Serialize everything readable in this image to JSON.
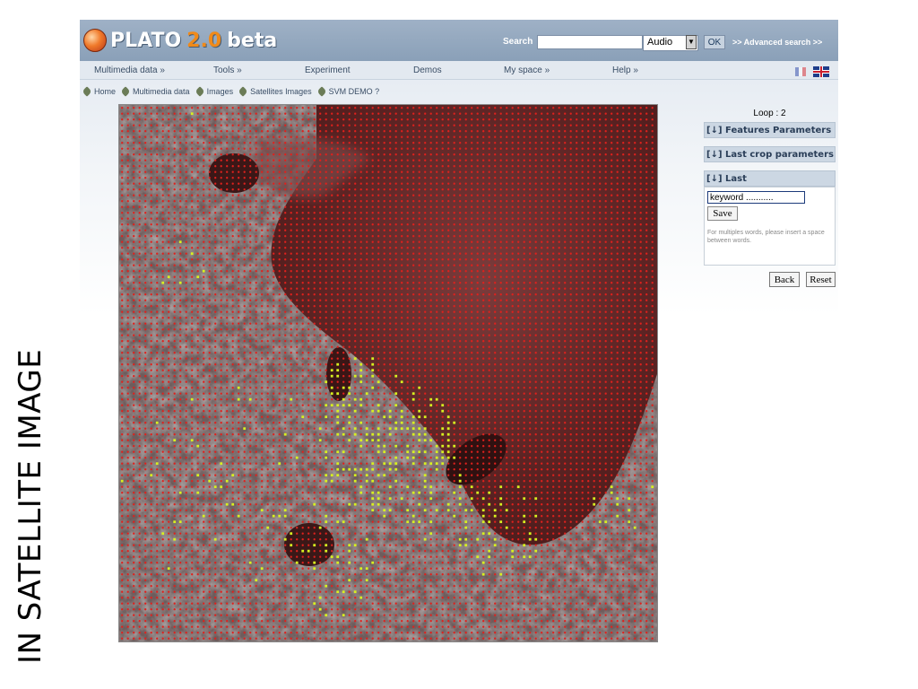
{
  "side_caption": "IN SATELLITE IMAGE",
  "header": {
    "logo_name": "PLATO",
    "logo_version": "2.0",
    "logo_suffix": "beta",
    "search_label": "Search",
    "search_value": "",
    "type_selected": "Audio",
    "ok_label": "OK",
    "advanced_link": ">> Advanced search >>"
  },
  "menu": [
    {
      "label": "Multimedia data »"
    },
    {
      "label": "Tools »"
    },
    {
      "label": "Experiment"
    },
    {
      "label": "Demos"
    },
    {
      "label": "My space »"
    },
    {
      "label": "Help »"
    }
  ],
  "breadcrumb": [
    "Home",
    "Multimedia data",
    "Images",
    "Satellites Images",
    "SVM DEMO ?"
  ],
  "panel": {
    "loop": "Loop : 2",
    "features_header": "Features Parameters",
    "crop_header": "Last crop parameters",
    "last_header": "Last",
    "keyword_value": "keyword ...........",
    "save_label": "Save",
    "help_text": "For multiples words, please insert a space between words.",
    "back_label": "Back",
    "reset_label": "Reset",
    "collapse_glyph": "[↓]"
  },
  "colors": {
    "negative_marker": "#e0201c",
    "positive_marker": "#d8f020"
  }
}
